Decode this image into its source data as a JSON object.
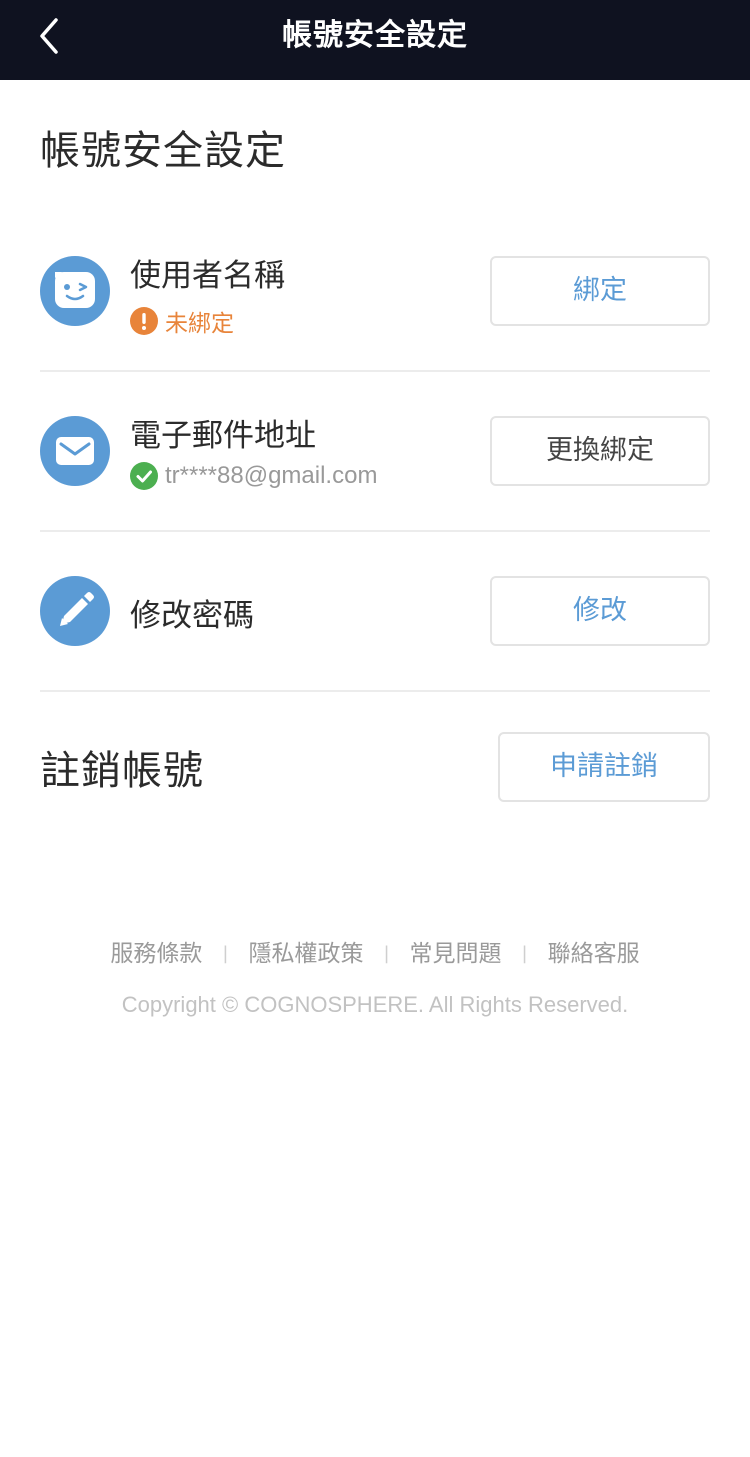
{
  "navbar": {
    "title": "帳號安全設定",
    "back_icon": "chevron-left-icon"
  },
  "page": {
    "title": "帳號安全設定"
  },
  "rows": [
    {
      "label": "使用者名稱",
      "icon": "face-icon",
      "status_icon": "warning-icon",
      "status_text": "未綁定",
      "status_color": "#e8843a",
      "button_label": "綁定"
    },
    {
      "label": "電子郵件地址",
      "icon": "mail-icon",
      "status_icon": "check-icon",
      "status_text": "tr****88@gmail.com",
      "status_color": "#4caf50",
      "button_label": "更換綁定"
    },
    {
      "label": "修改密碼",
      "icon": "pencil-icon",
      "button_label": "修改"
    }
  ],
  "cancel_account": {
    "title": "註銷帳號",
    "button_label": "申請註銷"
  },
  "footer": {
    "links": [
      "服務條款",
      "隱私權政策",
      "常見問題",
      "聯絡客服"
    ],
    "separator": "|",
    "copyright": "Copyright © COGNOSPHERE. All Rights Reserved."
  },
  "colors": {
    "accent": "#5b9bd5",
    "navbar_bg": "#0f1220",
    "warning": "#e8843a",
    "success": "#4caf50"
  }
}
